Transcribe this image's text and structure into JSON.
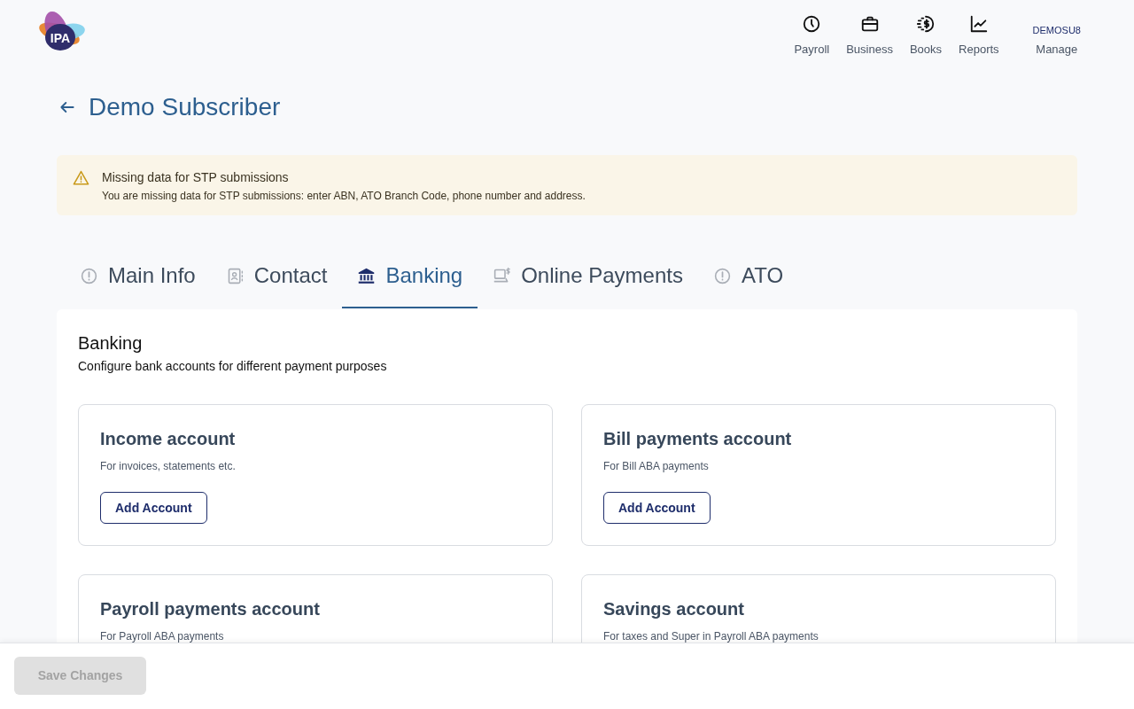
{
  "logo": {
    "text": "IPA"
  },
  "nav": [
    {
      "label": "Payroll"
    },
    {
      "label": "Business"
    },
    {
      "label": "Books"
    },
    {
      "label": "Reports"
    }
  ],
  "account": {
    "code": "DEMOSU8",
    "label": "Manage"
  },
  "page_title": "Demo Subscriber",
  "alert": {
    "title": "Missing data for STP submissions",
    "message": "You are missing data for STP submissions: enter ABN, ATO Branch Code, phone number and address."
  },
  "tabs": [
    {
      "label": "Main Info",
      "selected": false
    },
    {
      "label": "Contact",
      "selected": false
    },
    {
      "label": "Banking",
      "selected": true
    },
    {
      "label": "Online Payments",
      "selected": false
    },
    {
      "label": "ATO",
      "selected": false
    }
  ],
  "section": {
    "title": "Banking",
    "subtitle": "Configure bank accounts for different payment purposes"
  },
  "accounts": [
    {
      "title": "Income account",
      "description": "For invoices, statements etc.",
      "button": "Add Account"
    },
    {
      "title": "Bill payments account",
      "description": "For Bill ABA payments",
      "button": "Add Account"
    },
    {
      "title": "Payroll payments account",
      "description": "For Payroll ABA payments"
    },
    {
      "title": "Savings account",
      "description": "For taxes and Super in Payroll ABA payments"
    }
  ],
  "footer": {
    "button": {
      "label": "Save Changes",
      "disabled": true
    }
  }
}
